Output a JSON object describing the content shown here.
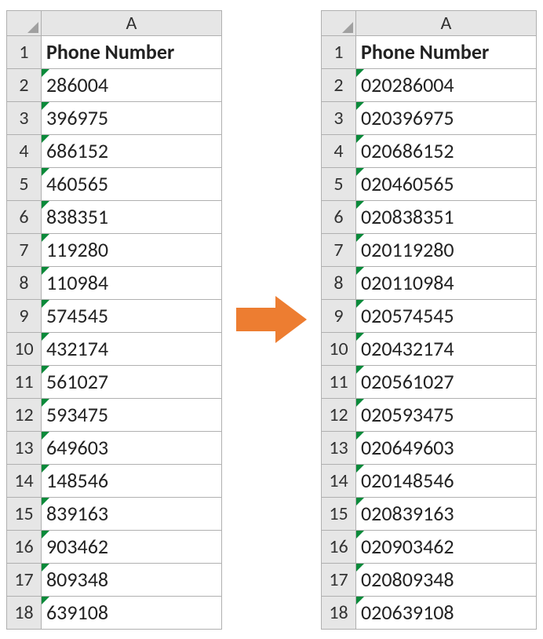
{
  "left": {
    "col_label": "A",
    "header": "Phone Number",
    "rows": [
      {
        "n": "1",
        "v": "Phone Number",
        "flag": false,
        "bold": true
      },
      {
        "n": "2",
        "v": "286004",
        "flag": true,
        "bold": false
      },
      {
        "n": "3",
        "v": "396975",
        "flag": true,
        "bold": false
      },
      {
        "n": "4",
        "v": "686152",
        "flag": true,
        "bold": false
      },
      {
        "n": "5",
        "v": "460565",
        "flag": true,
        "bold": false
      },
      {
        "n": "6",
        "v": "838351",
        "flag": true,
        "bold": false
      },
      {
        "n": "7",
        "v": "119280",
        "flag": true,
        "bold": false
      },
      {
        "n": "8",
        "v": "110984",
        "flag": true,
        "bold": false
      },
      {
        "n": "9",
        "v": "574545",
        "flag": true,
        "bold": false
      },
      {
        "n": "10",
        "v": "432174",
        "flag": true,
        "bold": false
      },
      {
        "n": "11",
        "v": "561027",
        "flag": true,
        "bold": false
      },
      {
        "n": "12",
        "v": "593475",
        "flag": true,
        "bold": false
      },
      {
        "n": "13",
        "v": "649603",
        "flag": true,
        "bold": false
      },
      {
        "n": "14",
        "v": "148546",
        "flag": true,
        "bold": false
      },
      {
        "n": "15",
        "v": "839163",
        "flag": true,
        "bold": false
      },
      {
        "n": "16",
        "v": "903462",
        "flag": true,
        "bold": false
      },
      {
        "n": "17",
        "v": "809348",
        "flag": true,
        "bold": false
      },
      {
        "n": "18",
        "v": "639108",
        "flag": true,
        "bold": false
      }
    ]
  },
  "right": {
    "col_label": "A",
    "header": "Phone Number",
    "rows": [
      {
        "n": "1",
        "v": "Phone Number",
        "flag": false,
        "bold": true
      },
      {
        "n": "2",
        "v": "020286004",
        "flag": true,
        "bold": false
      },
      {
        "n": "3",
        "v": "020396975",
        "flag": true,
        "bold": false
      },
      {
        "n": "4",
        "v": "020686152",
        "flag": true,
        "bold": false
      },
      {
        "n": "5",
        "v": "020460565",
        "flag": true,
        "bold": false
      },
      {
        "n": "6",
        "v": "020838351",
        "flag": true,
        "bold": false
      },
      {
        "n": "7",
        "v": "020119280",
        "flag": true,
        "bold": false
      },
      {
        "n": "8",
        "v": "020110984",
        "flag": true,
        "bold": false
      },
      {
        "n": "9",
        "v": "020574545",
        "flag": true,
        "bold": false
      },
      {
        "n": "10",
        "v": "020432174",
        "flag": true,
        "bold": false
      },
      {
        "n": "11",
        "v": "020561027",
        "flag": true,
        "bold": false
      },
      {
        "n": "12",
        "v": "020593475",
        "flag": true,
        "bold": false
      },
      {
        "n": "13",
        "v": "020649603",
        "flag": true,
        "bold": false
      },
      {
        "n": "14",
        "v": "020148546",
        "flag": true,
        "bold": false
      },
      {
        "n": "15",
        "v": "020839163",
        "flag": true,
        "bold": false
      },
      {
        "n": "16",
        "v": "020903462",
        "flag": true,
        "bold": false
      },
      {
        "n": "17",
        "v": "020809348",
        "flag": true,
        "bold": false
      },
      {
        "n": "18",
        "v": "020639108",
        "flag": true,
        "bold": false
      }
    ]
  }
}
